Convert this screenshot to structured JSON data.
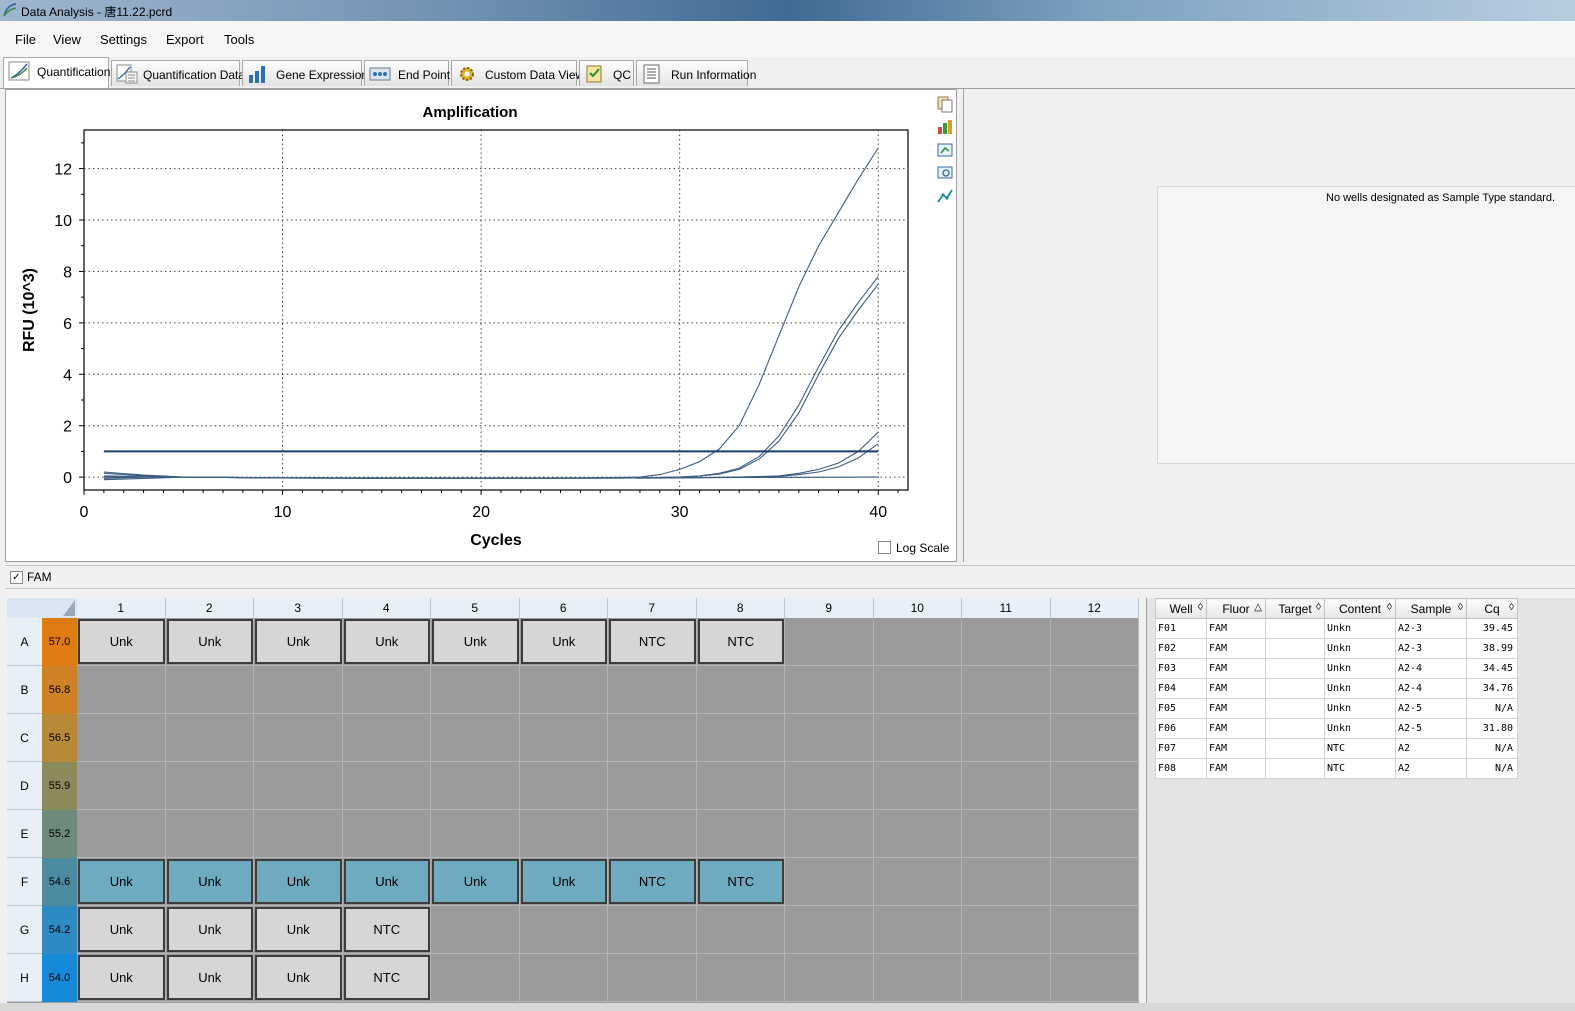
{
  "window": {
    "title": "Data Analysis - 唐11.22.pcrd"
  },
  "menu": [
    "File",
    "View",
    "Settings",
    "Export",
    "Tools"
  ],
  "tabs": [
    {
      "label": "Quantification",
      "icon": "amplification-curve-icon",
      "active": true
    },
    {
      "label": "Quantification Data",
      "icon": "quantification-data-icon",
      "active": false
    },
    {
      "label": "Gene Expression",
      "icon": "bar-chart-icon",
      "active": false
    },
    {
      "label": "End Point",
      "icon": "end-point-icon",
      "active": false
    },
    {
      "label": "Custom Data View",
      "icon": "gear-icon",
      "active": false
    },
    {
      "label": "QC",
      "icon": "qc-checklist-icon",
      "active": false
    },
    {
      "label": "Run Information",
      "icon": "document-icon",
      "active": false
    }
  ],
  "chart_data": {
    "type": "line",
    "title": "Amplification",
    "xlabel": "Cycles",
    "ylabel": "RFU (10^3)",
    "xlim": [
      0,
      41.5
    ],
    "ylim": [
      -0.5,
      13.5
    ],
    "xticks": [
      0,
      10,
      20,
      30,
      40
    ],
    "yticks": [
      0,
      2,
      4,
      6,
      8,
      10,
      12
    ],
    "grid": true,
    "threshold": 1.0,
    "series": [
      {
        "x": [
          1,
          3,
          5,
          10,
          20,
          25,
          28,
          29,
          30,
          31,
          32,
          33,
          34,
          35,
          36,
          37,
          38,
          39,
          40
        ],
        "y": [
          0.15,
          0.05,
          0.0,
          -0.03,
          -0.05,
          -0.03,
          0.0,
          0.1,
          0.3,
          0.6,
          1.1,
          2.0,
          3.6,
          5.5,
          7.4,
          9.0,
          10.3,
          11.6,
          12.8
        ]
      },
      {
        "x": [
          1,
          3,
          5,
          10,
          20,
          28,
          30,
          31,
          32,
          33,
          34,
          35,
          36,
          37,
          38,
          39,
          40
        ],
        "y": [
          0.2,
          0.08,
          0.0,
          -0.03,
          -0.05,
          -0.03,
          0.0,
          0.05,
          0.15,
          0.35,
          0.8,
          1.6,
          2.8,
          4.3,
          5.7,
          6.8,
          7.8
        ]
      },
      {
        "x": [
          1,
          3,
          5,
          10,
          20,
          28,
          30,
          31,
          32,
          33,
          34,
          35,
          36,
          37,
          38,
          39,
          40
        ],
        "y": [
          -0.1,
          -0.05,
          0.0,
          -0.03,
          -0.05,
          -0.03,
          0.0,
          0.04,
          0.12,
          0.3,
          0.7,
          1.4,
          2.5,
          4.0,
          5.4,
          6.5,
          7.5
        ]
      },
      {
        "x": [
          1,
          3,
          5,
          10,
          20,
          30,
          33,
          35,
          36,
          37,
          38,
          39,
          40
        ],
        "y": [
          0.05,
          0.02,
          0.0,
          -0.03,
          -0.05,
          -0.03,
          0.0,
          0.05,
          0.15,
          0.3,
          0.55,
          1.0,
          1.75
        ]
      },
      {
        "x": [
          1,
          3,
          5,
          10,
          20,
          30,
          33,
          35,
          36,
          37,
          38,
          39,
          40
        ],
        "y": [
          -0.05,
          0.0,
          0.0,
          -0.03,
          -0.05,
          -0.03,
          0.0,
          0.03,
          0.1,
          0.2,
          0.4,
          0.75,
          1.3
        ]
      },
      {
        "x": [
          1,
          5,
          10,
          20,
          30,
          40
        ],
        "y": [
          0.0,
          0.0,
          -0.02,
          -0.03,
          -0.02,
          0.0
        ]
      }
    ]
  },
  "log_scale": {
    "label": "Log Scale",
    "checked": false
  },
  "standard_message": "No wells designated as Sample Type standard.",
  "fluor_filter": {
    "label": "FAM",
    "checked": true
  },
  "plate": {
    "columns": [
      "1",
      "2",
      "3",
      "4",
      "5",
      "6",
      "7",
      "8",
      "9",
      "10",
      "11",
      "12"
    ],
    "rows": [
      {
        "label": "A",
        "temp": "57.0",
        "color": "#e07b12"
      },
      {
        "label": "B",
        "temp": "56.8",
        "color": "#cf8225"
      },
      {
        "label": "C",
        "temp": "56.5",
        "color": "#b78a3a"
      },
      {
        "label": "D",
        "temp": "55.9",
        "color": "#8a8a5a"
      },
      {
        "label": "E",
        "temp": "55.2",
        "color": "#6d8a7a"
      },
      {
        "label": "F",
        "temp": "54.6",
        "color": "#4b8aa0"
      },
      {
        "label": "G",
        "temp": "54.2",
        "color": "#2e8ac2"
      },
      {
        "label": "H",
        "temp": "54.0",
        "color": "#168ad8"
      }
    ],
    "wells": [
      {
        "row": 0,
        "col": 0,
        "text": "Unk",
        "style": "gray"
      },
      {
        "row": 0,
        "col": 1,
        "text": "Unk",
        "style": "gray"
      },
      {
        "row": 0,
        "col": 2,
        "text": "Unk",
        "style": "gray"
      },
      {
        "row": 0,
        "col": 3,
        "text": "Unk",
        "style": "gray"
      },
      {
        "row": 0,
        "col": 4,
        "text": "Unk",
        "style": "gray"
      },
      {
        "row": 0,
        "col": 5,
        "text": "Unk",
        "style": "gray"
      },
      {
        "row": 0,
        "col": 6,
        "text": "NTC",
        "style": "gray"
      },
      {
        "row": 0,
        "col": 7,
        "text": "NTC",
        "style": "gray"
      },
      {
        "row": 5,
        "col": 0,
        "text": "Unk",
        "style": "teal"
      },
      {
        "row": 5,
        "col": 1,
        "text": "Unk",
        "style": "teal"
      },
      {
        "row": 5,
        "col": 2,
        "text": "Unk",
        "style": "teal"
      },
      {
        "row": 5,
        "col": 3,
        "text": "Unk",
        "style": "teal"
      },
      {
        "row": 5,
        "col": 4,
        "text": "Unk",
        "style": "teal"
      },
      {
        "row": 5,
        "col": 5,
        "text": "Unk",
        "style": "teal"
      },
      {
        "row": 5,
        "col": 6,
        "text": "NTC",
        "style": "teal"
      },
      {
        "row": 5,
        "col": 7,
        "text": "NTC",
        "style": "teal"
      },
      {
        "row": 6,
        "col": 0,
        "text": "Unk",
        "style": "gray"
      },
      {
        "row": 6,
        "col": 1,
        "text": "Unk",
        "style": "gray"
      },
      {
        "row": 6,
        "col": 2,
        "text": "Unk",
        "style": "gray"
      },
      {
        "row": 6,
        "col": 3,
        "text": "NTC",
        "style": "gray"
      },
      {
        "row": 7,
        "col": 0,
        "text": "Unk",
        "style": "gray"
      },
      {
        "row": 7,
        "col": 1,
        "text": "Unk",
        "style": "gray"
      },
      {
        "row": 7,
        "col": 2,
        "text": "Unk",
        "style": "gray"
      },
      {
        "row": 7,
        "col": 3,
        "text": "NTC",
        "style": "gray"
      }
    ]
  },
  "results_table": {
    "columns": [
      {
        "label": "Well",
        "sort": "◊"
      },
      {
        "label": "Fluor",
        "sort": "△"
      },
      {
        "label": "Target",
        "sort": "◊"
      },
      {
        "label": "Content",
        "sort": "◊"
      },
      {
        "label": "Sample",
        "sort": "◊"
      },
      {
        "label": "Cq",
        "sort": "◊"
      }
    ],
    "rows": [
      [
        "F01",
        "FAM",
        "",
        "Unkn",
        "A2-3",
        "39.45"
      ],
      [
        "F02",
        "FAM",
        "",
        "Unkn",
        "A2-3",
        "38.99"
      ],
      [
        "F03",
        "FAM",
        "",
        "Unkn",
        "A2-4",
        "34.45"
      ],
      [
        "F04",
        "FAM",
        "",
        "Unkn",
        "A2-4",
        "34.76"
      ],
      [
        "F05",
        "FAM",
        "",
        "Unkn",
        "A2-5",
        "N/A"
      ],
      [
        "F06",
        "FAM",
        "",
        "Unkn",
        "A2-5",
        "31.80"
      ],
      [
        "F07",
        "FAM",
        "",
        "NTC",
        "A2",
        "N/A"
      ],
      [
        "F08",
        "FAM",
        "",
        "NTC",
        "A2",
        "N/A"
      ]
    ]
  }
}
